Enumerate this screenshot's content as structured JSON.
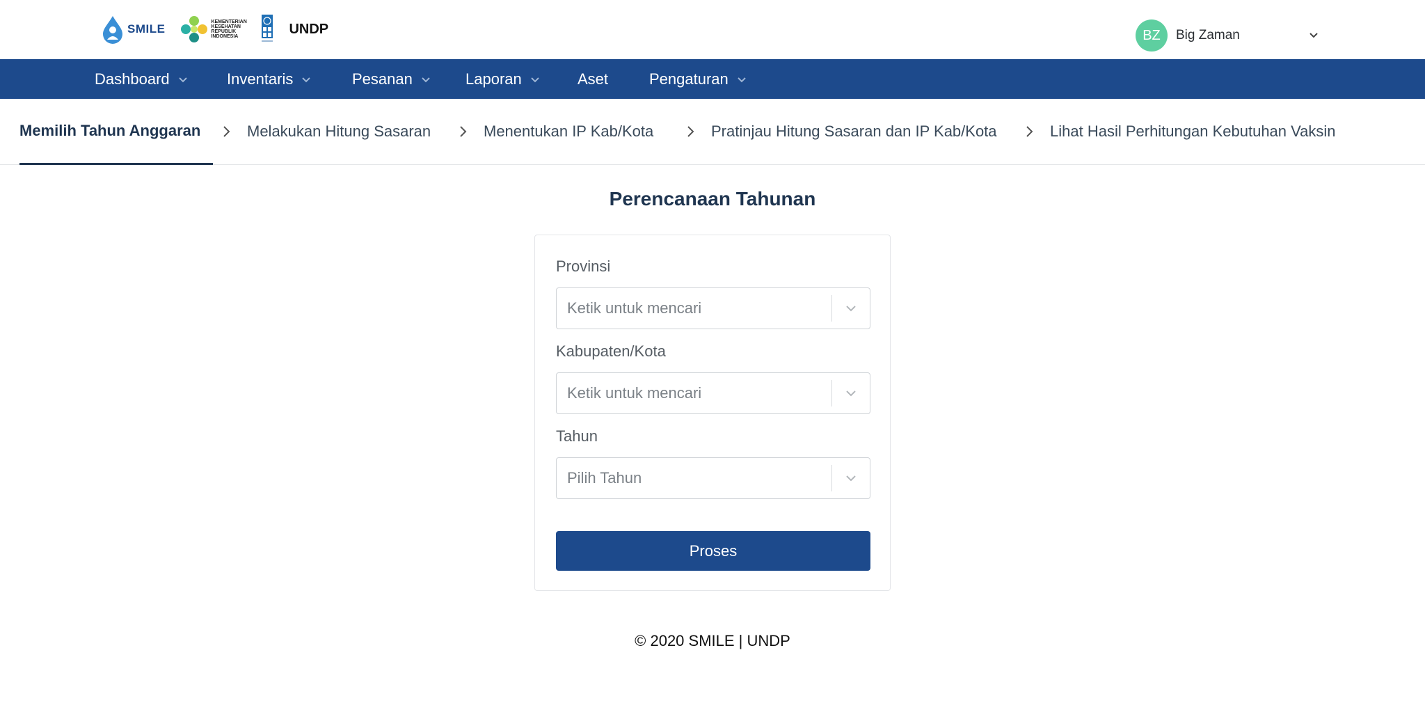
{
  "header": {
    "logos": {
      "smile_word": "SMILE",
      "kemkes_text": "KEMENTERIAN KESEHATAN REPUBLIK INDONESIA",
      "undp_text": "UNDP"
    },
    "user": {
      "initials": "BZ",
      "name": "Big Zaman",
      "avatar_color": "#5ecfa0"
    }
  },
  "nav": {
    "items": [
      {
        "label": "Dashboard",
        "has_dropdown": true
      },
      {
        "label": "Inventaris",
        "has_dropdown": true
      },
      {
        "label": "Pesanan",
        "has_dropdown": true
      },
      {
        "label": "Laporan",
        "has_dropdown": true
      },
      {
        "label": "Aset",
        "has_dropdown": false
      },
      {
        "label": "Pengaturan",
        "has_dropdown": true
      }
    ],
    "background_color": "#1d4a8c"
  },
  "steps": {
    "items": [
      {
        "label": "Memilih Tahun Anggaran",
        "active": true
      },
      {
        "label": "Melakukan Hitung Sasaran",
        "active": false
      },
      {
        "label": "Menentukan IP Kab/Kota",
        "active": false
      },
      {
        "label": "Pratinjau Hitung Sasaran dan IP Kab/Kota",
        "active": false
      },
      {
        "label": "Lihat Hasil Perhitungan Kebutuhan Vaksin",
        "active": false
      }
    ]
  },
  "main": {
    "title": "Perencanaan Tahunan",
    "form": {
      "provinsi": {
        "label": "Provinsi",
        "placeholder": "Ketik untuk mencari"
      },
      "kabupaten": {
        "label": "Kabupaten/Kota",
        "placeholder": "Ketik untuk mencari"
      },
      "tahun": {
        "label": "Tahun",
        "placeholder": "Pilih Tahun"
      },
      "submit_label": "Proses"
    }
  },
  "footer": {
    "text": "© 2020 SMILE | UNDP"
  },
  "icons": {
    "smile_logo": "smile-logo-icon",
    "kemkes_logo": "kemkes-logo-icon",
    "undp_logo": "undp-logo-icon",
    "chevron_down": "chevron-down-icon",
    "chevron_right": "chevron-right-icon"
  }
}
